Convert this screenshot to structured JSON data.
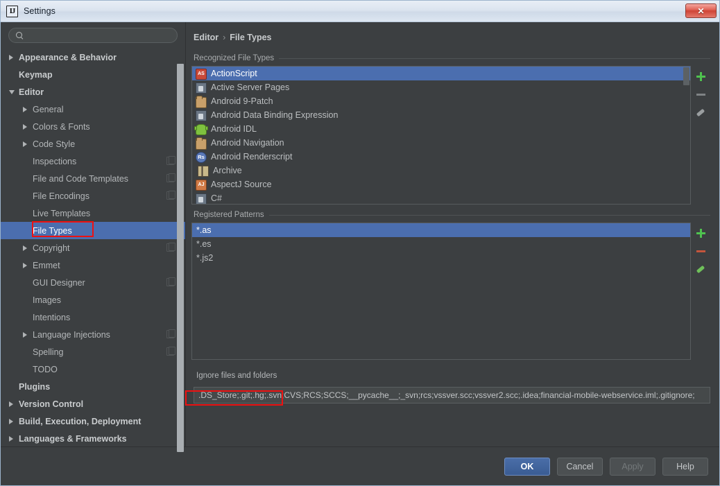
{
  "window": {
    "title": "Settings",
    "app_icon": "intellij-idea-icon",
    "close_label": "✕",
    "accent_selection": "#4b6eaf",
    "annotation_color": "#ee1111"
  },
  "search": {
    "value": "",
    "placeholder": "",
    "icon": "search-icon"
  },
  "sidebar": {
    "items": [
      {
        "label": "Appearance & Behavior",
        "level": 0,
        "arrow": "right",
        "bold": true,
        "selected": false,
        "copyable": false
      },
      {
        "label": "Keymap",
        "level": 0,
        "arrow": "none",
        "bold": true,
        "selected": false,
        "copyable": false
      },
      {
        "label": "Editor",
        "level": 0,
        "arrow": "down",
        "bold": true,
        "selected": false,
        "copyable": false
      },
      {
        "label": "General",
        "level": 1,
        "arrow": "right",
        "bold": false,
        "selected": false,
        "copyable": false
      },
      {
        "label": "Colors & Fonts",
        "level": 1,
        "arrow": "right",
        "bold": false,
        "selected": false,
        "copyable": false
      },
      {
        "label": "Code Style",
        "level": 1,
        "arrow": "right",
        "bold": false,
        "selected": false,
        "copyable": false
      },
      {
        "label": "Inspections",
        "level": 1,
        "arrow": "none",
        "bold": false,
        "selected": false,
        "copyable": true
      },
      {
        "label": "File and Code Templates",
        "level": 1,
        "arrow": "none",
        "bold": false,
        "selected": false,
        "copyable": true
      },
      {
        "label": "File Encodings",
        "level": 1,
        "arrow": "none",
        "bold": false,
        "selected": false,
        "copyable": true
      },
      {
        "label": "Live Templates",
        "level": 1,
        "arrow": "none",
        "bold": false,
        "selected": false,
        "copyable": false
      },
      {
        "label": "File Types",
        "level": 1,
        "arrow": "none",
        "bold": false,
        "selected": true,
        "copyable": false
      },
      {
        "label": "Copyright",
        "level": 1,
        "arrow": "right",
        "bold": false,
        "selected": false,
        "copyable": true
      },
      {
        "label": "Emmet",
        "level": 1,
        "arrow": "right",
        "bold": false,
        "selected": false,
        "copyable": false
      },
      {
        "label": "GUI Designer",
        "level": 1,
        "arrow": "none",
        "bold": false,
        "selected": false,
        "copyable": true
      },
      {
        "label": "Images",
        "level": 1,
        "arrow": "none",
        "bold": false,
        "selected": false,
        "copyable": false
      },
      {
        "label": "Intentions",
        "level": 1,
        "arrow": "none",
        "bold": false,
        "selected": false,
        "copyable": false
      },
      {
        "label": "Language Injections",
        "level": 1,
        "arrow": "right",
        "bold": false,
        "selected": false,
        "copyable": true
      },
      {
        "label": "Spelling",
        "level": 1,
        "arrow": "none",
        "bold": false,
        "selected": false,
        "copyable": true
      },
      {
        "label": "TODO",
        "level": 1,
        "arrow": "none",
        "bold": false,
        "selected": false,
        "copyable": false
      },
      {
        "label": "Plugins",
        "level": 0,
        "arrow": "none",
        "bold": true,
        "selected": false,
        "copyable": false
      },
      {
        "label": "Version Control",
        "level": 0,
        "arrow": "right",
        "bold": true,
        "selected": false,
        "copyable": false
      },
      {
        "label": "Build, Execution, Deployment",
        "level": 0,
        "arrow": "right",
        "bold": true,
        "selected": false,
        "copyable": false
      },
      {
        "label": "Languages & Frameworks",
        "level": 0,
        "arrow": "right",
        "bold": true,
        "selected": false,
        "copyable": false
      }
    ]
  },
  "breadcrumb": {
    "root": "Editor",
    "separator": "›",
    "current": "File Types"
  },
  "recognized": {
    "title": "Recognized File Types",
    "items": [
      {
        "name": "ActionScript",
        "icon": "actionscript-icon",
        "icon_text": "AS",
        "selected": true
      },
      {
        "name": "Active Server Pages",
        "icon": "document-icon",
        "icon_text": "",
        "selected": false
      },
      {
        "name": "Android 9-Patch",
        "icon": "folder-icon",
        "icon_text": "",
        "selected": false
      },
      {
        "name": "Android Data Binding Expression",
        "icon": "document-icon",
        "icon_text": "",
        "selected": false
      },
      {
        "name": "Android IDL",
        "icon": "android-icon",
        "icon_text": "",
        "selected": false
      },
      {
        "name": "Android Navigation",
        "icon": "folder-icon",
        "icon_text": "",
        "selected": false
      },
      {
        "name": "Android Renderscript",
        "icon": "renderscript-icon",
        "icon_text": "Rs",
        "selected": false
      },
      {
        "name": "Archive",
        "icon": "archive-icon",
        "icon_text": "",
        "selected": false
      },
      {
        "name": "AspectJ Source",
        "icon": "aspectj-icon",
        "icon_text": "AJ",
        "selected": false
      },
      {
        "name": "C#",
        "icon": "document-icon",
        "icon_text": "",
        "selected": false
      }
    ],
    "toolbar": [
      {
        "name": "add-file-type-button",
        "icon": "plus-icon",
        "enabled": true
      },
      {
        "name": "remove-file-type-button",
        "icon": "minus-icon",
        "enabled": false
      },
      {
        "name": "edit-file-type-button",
        "icon": "pencil-icon",
        "enabled": false
      }
    ]
  },
  "patterns": {
    "title": "Registered Patterns",
    "items": [
      {
        "value": "*.as",
        "selected": true
      },
      {
        "value": "*.es",
        "selected": false
      },
      {
        "value": "*.js2",
        "selected": false
      }
    ],
    "toolbar": [
      {
        "name": "add-pattern-button",
        "icon": "plus-icon",
        "enabled": true
      },
      {
        "name": "remove-pattern-button",
        "icon": "minus-icon",
        "enabled": true
      },
      {
        "name": "edit-pattern-button",
        "icon": "pencil-icon",
        "enabled": true
      }
    ]
  },
  "ignore": {
    "label": "Ignore files and folders",
    "value": ".DS_Store;.git;.hg;.svn;CVS;RCS;SCCS;__pycache__;_svn;rcs;vssver.scc;vssver2.scc;.idea;financial-mobile-webservice.iml;.gitignore;"
  },
  "footer": {
    "ok": "OK",
    "cancel": "Cancel",
    "apply": "Apply",
    "help": "Help"
  }
}
